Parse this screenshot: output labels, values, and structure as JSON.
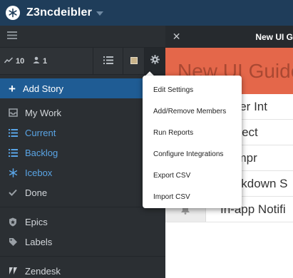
{
  "topbar": {
    "project_title": "Z3ncdeibler",
    "logo_icon": "pivotal-snowflake-icon"
  },
  "sidebar": {
    "stats": {
      "velocity": "10",
      "members": "1"
    },
    "add_story_label": "Add Story",
    "nav_primary": [
      {
        "label": "My Work",
        "icon": "inbox-icon"
      },
      {
        "label": "Current",
        "icon": "list-icon"
      },
      {
        "label": "Backlog",
        "icon": "list-icon"
      },
      {
        "label": "Icebox",
        "icon": "snowflake-icon"
      },
      {
        "label": "Done",
        "icon": "check-icon"
      }
    ],
    "nav_secondary": [
      {
        "label": "Epics",
        "icon": "shield-icon"
      },
      {
        "label": "Labels",
        "icon": "tag-icon"
      }
    ],
    "nav_integrations": [
      {
        "label": "Zendesk",
        "icon": "zendesk-icon"
      }
    ]
  },
  "panel": {
    "title": "New UI G",
    "banner_heading": "New UI Guide",
    "rows": [
      {
        "text": "ew User Int",
        "thumb": ""
      },
      {
        "text": "ultiproject",
        "thumb": ""
      },
      {
        "text": "arch Impr",
        "thumb": ""
      },
      {
        "text": "Markdown S",
        "thumb": "markdown-icon"
      },
      {
        "text": "In-app Notifi",
        "thumb": "bell-icon"
      }
    ]
  },
  "settings_menu": {
    "items": [
      "Edit Settings",
      "Add/Remove Members",
      "Run Reports",
      "Configure Integrations",
      "Export CSV",
      "Import CSV"
    ]
  },
  "colors": {
    "topbar": "#1f3d5a",
    "sidebar": "#2b2f33",
    "add_story": "#1f5c94",
    "nav_active": "#5aa5e6",
    "banner": "#e4674a"
  }
}
